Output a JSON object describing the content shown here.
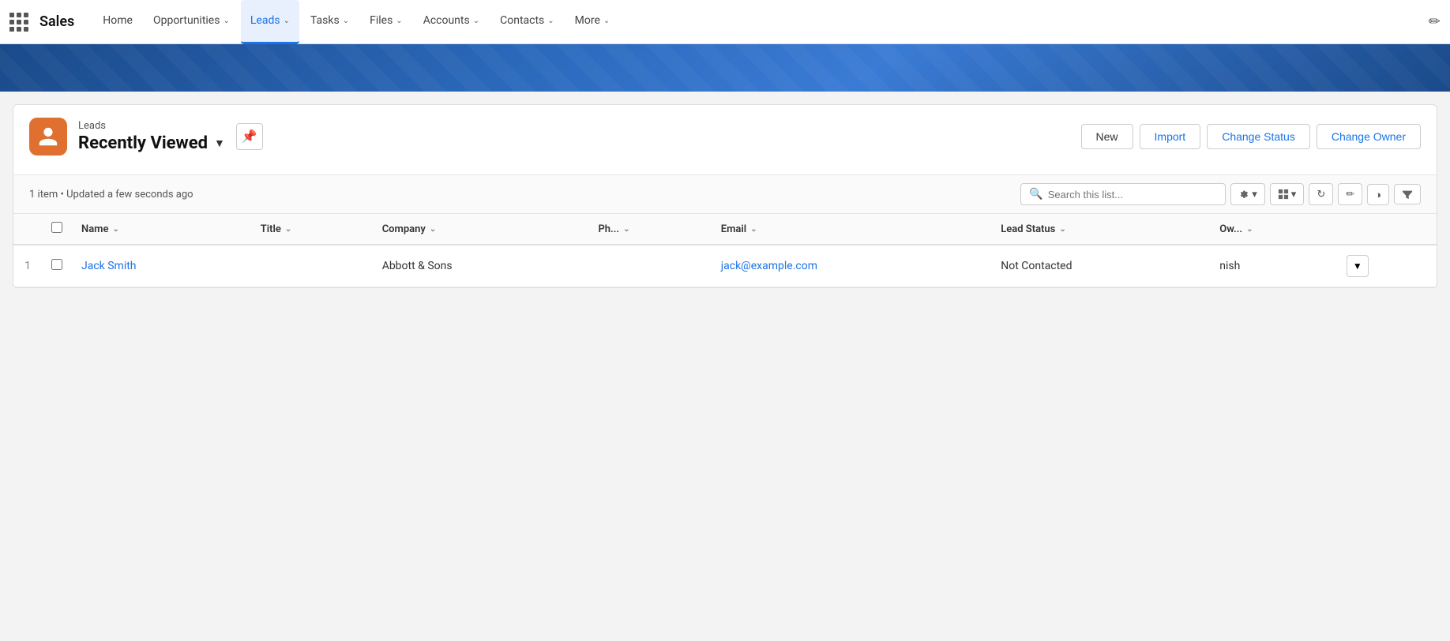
{
  "app": {
    "brand": "Sales",
    "edit_icon": "✏"
  },
  "nav": {
    "items": [
      {
        "id": "home",
        "label": "Home",
        "has_chevron": false,
        "active": false
      },
      {
        "id": "opportunities",
        "label": "Opportunities",
        "has_chevron": true,
        "active": false
      },
      {
        "id": "leads",
        "label": "Leads",
        "has_chevron": true,
        "active": true
      },
      {
        "id": "tasks",
        "label": "Tasks",
        "has_chevron": true,
        "active": false
      },
      {
        "id": "files",
        "label": "Files",
        "has_chevron": true,
        "active": false
      },
      {
        "id": "accounts",
        "label": "Accounts",
        "has_chevron": true,
        "active": false
      },
      {
        "id": "contacts",
        "label": "Contacts",
        "has_chevron": true,
        "active": false
      },
      {
        "id": "more",
        "label": "More",
        "has_chevron": true,
        "active": false
      }
    ]
  },
  "page": {
    "title_label": "Leads",
    "title_main": "Recently Viewed",
    "item_count": "1 item",
    "updated_text": "Updated a few seconds ago",
    "search_placeholder": "Search this list..."
  },
  "action_buttons": [
    {
      "id": "new",
      "label": "New",
      "style": "new"
    },
    {
      "id": "import",
      "label": "Import",
      "style": "primary"
    },
    {
      "id": "change-status",
      "label": "Change Status",
      "style": "primary"
    },
    {
      "id": "change-owner",
      "label": "Change Owner",
      "style": "primary"
    }
  ],
  "table": {
    "columns": [
      {
        "id": "name",
        "label": "Name"
      },
      {
        "id": "title",
        "label": "Title"
      },
      {
        "id": "company",
        "label": "Company"
      },
      {
        "id": "phone",
        "label": "Ph..."
      },
      {
        "id": "email",
        "label": "Email"
      },
      {
        "id": "lead_status",
        "label": "Lead Status"
      },
      {
        "id": "owner",
        "label": "Ow..."
      }
    ],
    "rows": [
      {
        "row_num": "1",
        "name": "Jack Smith",
        "title": "",
        "company": "Abbott & Sons",
        "phone": "",
        "email": "jack@example.com",
        "lead_status": "Not Contacted",
        "owner": "nish"
      }
    ]
  }
}
